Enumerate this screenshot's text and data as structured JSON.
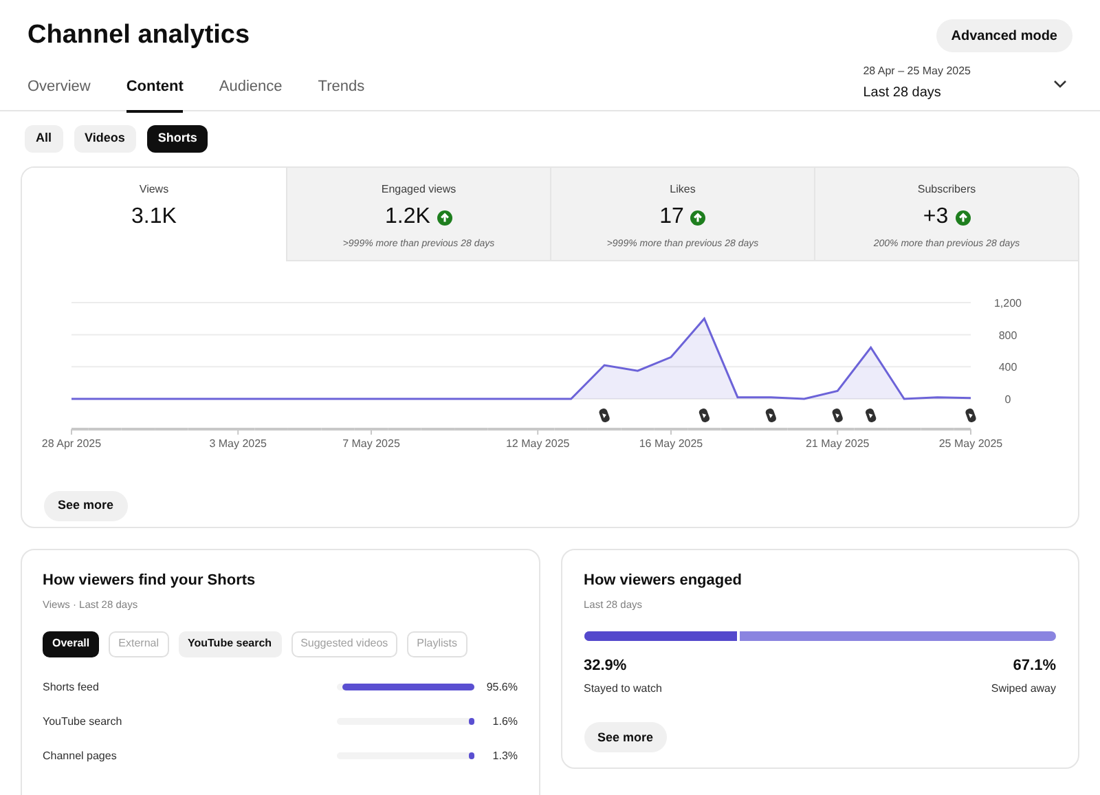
{
  "header": {
    "title": "Channel analytics",
    "advanced_button": "Advanced mode"
  },
  "tabs": [
    {
      "label": "Overview",
      "selected": false
    },
    {
      "label": "Content",
      "selected": true
    },
    {
      "label": "Audience",
      "selected": false
    },
    {
      "label": "Trends",
      "selected": false
    }
  ],
  "date_range": {
    "range": "28 Apr – 25 May 2025",
    "period": "Last 28 days"
  },
  "filters": [
    {
      "label": "All",
      "selected": false
    },
    {
      "label": "Videos",
      "selected": false
    },
    {
      "label": "Shorts",
      "selected": true
    }
  ],
  "metrics": [
    {
      "label": "Views",
      "value": "3.1K",
      "rising": false,
      "selected": true
    },
    {
      "label": "Engaged views",
      "value": "1.2K",
      "rising": true,
      "change": ">999% more than previous 28 days",
      "selected": false
    },
    {
      "label": "Likes",
      "value": "17",
      "rising": true,
      "change": ">999% more than previous 28 days",
      "selected": false
    },
    {
      "label": "Subscribers",
      "value": "+3",
      "rising": true,
      "change": "200% more than previous 28 days",
      "selected": false
    }
  ],
  "chart_data": {
    "type": "area",
    "categories": [
      "28 Apr 2025",
      null,
      null,
      null,
      null,
      "3 May 2025",
      null,
      null,
      null,
      "7 May 2025",
      null,
      null,
      null,
      null,
      "12 May 2025",
      null,
      null,
      null,
      "16 May 2025",
      null,
      null,
      null,
      null,
      "21 May 2025",
      null,
      null,
      null,
      "25 May 2025"
    ],
    "series": [
      {
        "color": "#6c63d8",
        "values": [
          0,
          0,
          0,
          0,
          0,
          0,
          0,
          0,
          0,
          0,
          0,
          0,
          0,
          0,
          0,
          0,
          420,
          350,
          520,
          1000,
          20,
          20,
          0,
          100,
          640,
          0,
          20,
          10
        ]
      }
    ],
    "yticks": [
      0,
      400,
      800,
      {
        "value": 1200,
        "label": "1,200"
      }
    ],
    "ylim": [
      0,
      1200
    ]
  },
  "shorts_posted": [
    false,
    false,
    false,
    false,
    false,
    false,
    false,
    false,
    false,
    false,
    false,
    false,
    false,
    false,
    false,
    false,
    true,
    false,
    false,
    true,
    false,
    true,
    false,
    true,
    true,
    false,
    false,
    true
  ],
  "see_more": "See more",
  "traffic": {
    "title": "How viewers find your Shorts",
    "subtitle": "Views · Last 28 days",
    "chips": [
      {
        "label": "Overall",
        "selected": true,
        "disabled": false
      },
      {
        "label": "External",
        "selected": false,
        "disabled": true
      },
      {
        "label": "YouTube search",
        "selected": false,
        "disabled": false
      },
      {
        "label": "Suggested videos",
        "selected": false,
        "disabled": true
      },
      {
        "label": "Playlists",
        "selected": false,
        "disabled": true
      }
    ],
    "rows": [
      {
        "name": "Shorts feed",
        "level": 0.956,
        "reading": "95.6%"
      },
      {
        "name": "YouTube search",
        "level": 0.016,
        "reading": "1.6%"
      },
      {
        "name": "Channel pages",
        "level": 0.013,
        "reading": "1.3%"
      }
    ]
  },
  "engagement": {
    "title": "How viewers engaged",
    "subtitle": "Last 28 days",
    "level": 0.329,
    "stayed": {
      "value": "32.9%",
      "label": "Stayed to watch"
    },
    "swiped": {
      "value": "67.1%",
      "label": "Swiped away"
    },
    "see_more": "See more"
  }
}
